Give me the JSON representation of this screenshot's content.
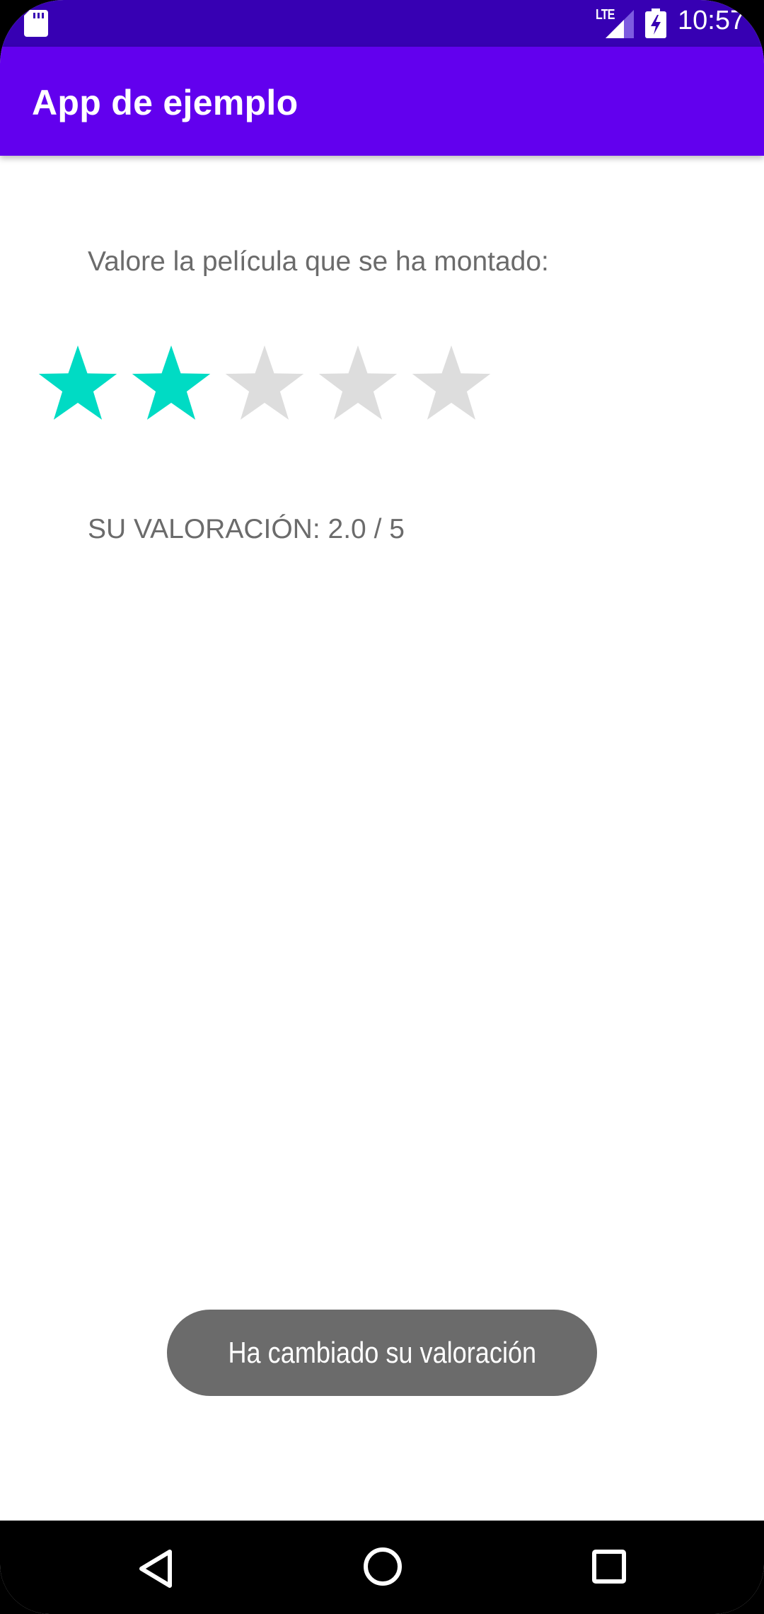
{
  "status_bar": {
    "time": "10:57",
    "network": "LTE",
    "icons": [
      "sd-card-icon",
      "signal-icon",
      "battery-charging-icon"
    ]
  },
  "app_bar": {
    "title": "App de ejemplo"
  },
  "content": {
    "prompt": "Valore la película que se ha montado:",
    "rating": {
      "value": 2,
      "max": 5,
      "filled_color": "#00dbc4",
      "empty_color": "#dddddd"
    },
    "result_text": "SU VALORACIÓN: 2.0 / 5"
  },
  "toast": {
    "message": "Ha cambiado su valoración"
  },
  "nav_bar": {
    "buttons": [
      "back-icon",
      "home-icon",
      "recent-apps-icon"
    ]
  },
  "colors": {
    "status_bar": "#3700b3",
    "app_bar": "#6200ee",
    "text_secondary": "#6b6b6b",
    "toast_bg": "#6b6b6b"
  }
}
